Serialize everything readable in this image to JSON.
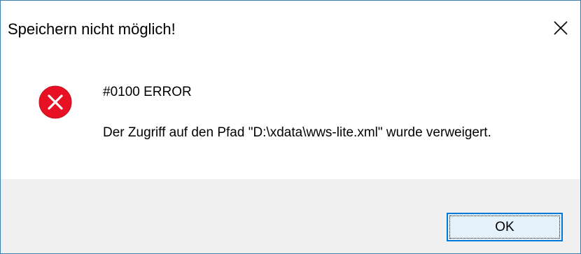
{
  "window": {
    "title": "Speichern nicht möglich!",
    "close_icon": "close-icon"
  },
  "message": {
    "icon": "error-icon",
    "code": "#0100 ERROR",
    "text": "Der Zugriff auf den Pfad \"D:\\xdata\\wws-lite.xml\" wurde verweigert."
  },
  "buttons": {
    "ok_label": "OK"
  },
  "colors": {
    "error_red": "#e81123",
    "accent_blue": "#0078d7",
    "footer_bg": "#f0f0f0"
  }
}
